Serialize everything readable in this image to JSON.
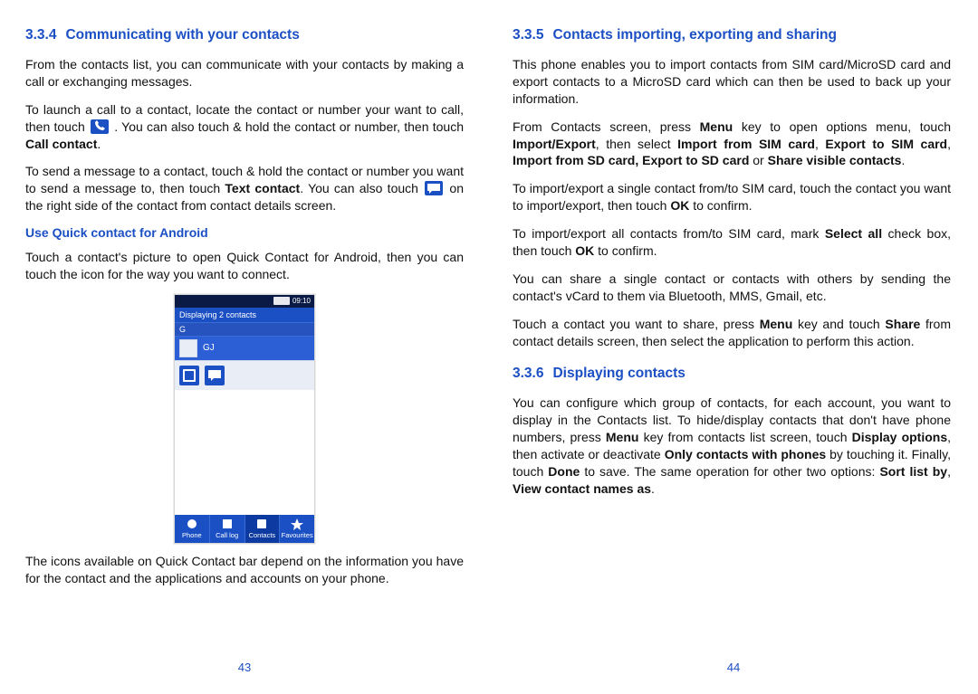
{
  "left": {
    "h_num": "3.3.4",
    "h_title": "Communicating with your contacts",
    "p1": "From the contacts list, you can communicate with your contacts by making a call or exchanging messages.",
    "p2a": "To launch a call to a contact, locate the contact or number your want to call, then touch ",
    "p2b": " . You can also touch & hold the contact or number, then touch ",
    "p2_strong": "Call contact",
    "p2c": ".",
    "p3a": "To send a message to a contact, touch & hold the contact or number you want to send a message to, then touch ",
    "p3_strong": "Text contact",
    "p3b": ". You can also touch ",
    "p3c": " on the right side of the contact from contact details screen.",
    "sub": "Use Quick contact for Android",
    "p4": "Touch a contact's picture to open Quick Contact for Android, then you can touch the icon for the way you want to connect.",
    "p5": "The icons available on Quick Contact bar depend on the information you have for the contact and the applications and accounts on your phone.",
    "page_num": "43"
  },
  "phone": {
    "time": "09:10",
    "banner": "Displaying 2 contacts",
    "letterG": "G",
    "contactName": "GJ",
    "nav": [
      "Phone",
      "Call log",
      "Contacts",
      "Favourites"
    ]
  },
  "right": {
    "h1_num": "3.3.5",
    "h1_title": "Contacts importing, exporting and sharing",
    "r1": "This phone enables you to import contacts from SIM card/MicroSD card and export contacts to a MicroSD card which can then be used to back up your information.",
    "r2a": "From Contacts screen, press ",
    "r2_menu": "Menu",
    "r2b": " key to open options menu, touch ",
    "r2_ie": "Import/Export",
    "r2c": ", then select ",
    "r2_isim": "Import from SIM card",
    "r2d": ", ",
    "r2_esim": "Export to SIM card",
    "r2e": ", ",
    "r2_isd": "Import from SD card, Export to SD card",
    "r2f": " or ",
    "r2_share": "Share visible contacts",
    "r2g": ".",
    "r3a": "To import/export a single contact from/to SIM card, touch the contact you want to import/export, then touch ",
    "r3_ok": "OK",
    "r3b": " to confirm.",
    "r4a": "To import/export all contacts from/to SIM card, mark ",
    "r4_sel": "Select all",
    "r4b": " check box, then touch ",
    "r4_ok": "OK",
    "r4c": " to confirm.",
    "r5": "You can share a single contact or contacts with others by sending the contact's vCard to them via Bluetooth, MMS, Gmail, etc.",
    "r6a": "Touch a contact you want to share, press ",
    "r6_menu": "Menu",
    "r6b": " key and touch ",
    "r6_share": "Share",
    "r6c": " from contact details screen, then select the application to perform this action.",
    "h2_num": "3.3.6",
    "h2_title": "Displaying contacts",
    "r7a": "You can configure which group of contacts, for each account, you want to display in the Contacts list. To hide/display contacts that don't have phone numbers, press ",
    "r7_menu": "Menu",
    "r7b": " key from contacts list screen, touch ",
    "r7_disp": "Display options",
    "r7c": ", then activate or deactivate ",
    "r7_only": "Only contacts with phones",
    "r7d": " by touching it. Finally, touch ",
    "r7_done": "Done",
    "r7e": " to save. The same operation for other two options: ",
    "r7_sort": "Sort list by",
    "r7f": ", ",
    "r7_view": "View contact names as",
    "r7g": ".",
    "page_num": "44"
  }
}
